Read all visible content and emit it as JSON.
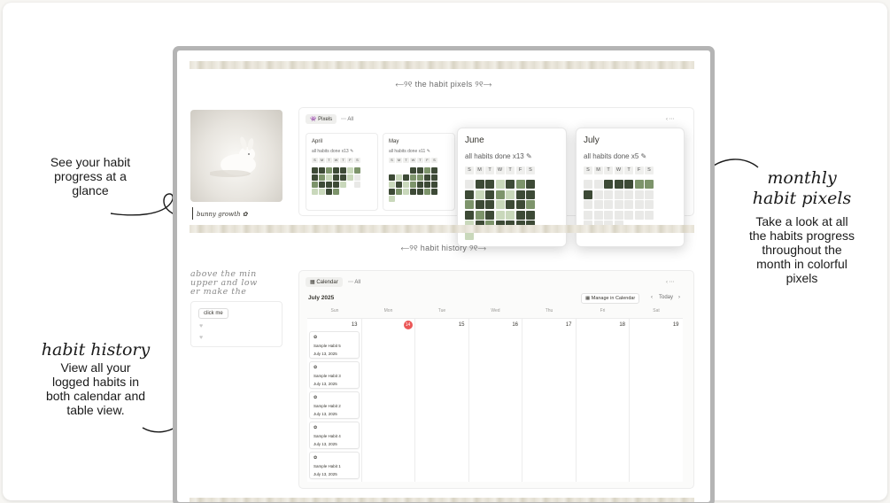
{
  "left_annotations": {
    "progress_text": [
      "See your habit",
      "progress at a",
      "glance"
    ],
    "history_title": "habit history",
    "history_text": [
      "View all your",
      "logged habits in",
      "both calendar and",
      "table view."
    ]
  },
  "right_annotations": {
    "pixels_title": [
      "monthly",
      "habit pixels"
    ],
    "pixels_text": [
      "Take a look at all",
      "the habits progress",
      "throughout the",
      "month in colorful",
      "pixels"
    ]
  },
  "notion": {
    "pixels_heading": "⟵୨୧ the habit pixels ୨୧⟶",
    "history_heading": "⟵୨୧ habit history ୨୧⟶",
    "photo_caption": "bunny growth ✿",
    "pixels_view": {
      "tabs": [
        "Pixels",
        "All"
      ],
      "tab_icons": [
        "👾",
        "⋯"
      ],
      "controls": "‹  ⋯"
    },
    "months": [
      {
        "name": "April",
        "done_text": "all habits done x13 ✎"
      },
      {
        "name": "May",
        "done_text": "all habits done x11 ✎"
      }
    ],
    "popup_months": [
      {
        "name": "June",
        "done_text": "all habits done x13 ✎"
      },
      {
        "name": "July",
        "done_text": "all habits done x5 ✎"
      }
    ],
    "weekday_letters": [
      "S",
      "M",
      "T",
      "W",
      "T",
      "F",
      "S"
    ],
    "script_lines": [
      "above the min",
      "upper and low",
      "er make the"
    ],
    "click_button": "click me",
    "hearts": [
      "♥",
      "♥"
    ],
    "calendar": {
      "tabs": [
        "Calendar",
        "All"
      ],
      "tab_icons": [
        "▦",
        "⋯"
      ],
      "controls": "‹  ⋯",
      "month_title": "July 2025",
      "manage_button": "Manage in Calendar",
      "today_label": "Today",
      "prev": "‹",
      "next": "›",
      "weekdays": [
        "Sun",
        "Mon",
        "Tue",
        "Wed",
        "Thu",
        "Fri",
        "Sat"
      ],
      "day_numbers": [
        "13",
        "14",
        "15",
        "16",
        "17",
        "18",
        "19"
      ],
      "events": [
        {
          "icon": "✿",
          "name": "Sample Habit 5",
          "date": "July 13, 2025"
        },
        {
          "icon": "✿",
          "name": "Sample Habit 3",
          "date": "July 13, 2025"
        },
        {
          "icon": "✿",
          "name": "Sample Habit 2",
          "date": "July 13, 2025"
        },
        {
          "icon": "✿",
          "name": "Sample Habit 4",
          "date": "July 13, 2025"
        },
        {
          "icon": "✿",
          "name": "Sample Habit 1",
          "date": "July 13, 2025"
        }
      ]
    }
  },
  "colors": {
    "dark": "#3d4a36",
    "mid": "#7d946b",
    "light": "#c9d8bb",
    "empty": "#e9e9e7",
    "today": "#eb5757"
  }
}
